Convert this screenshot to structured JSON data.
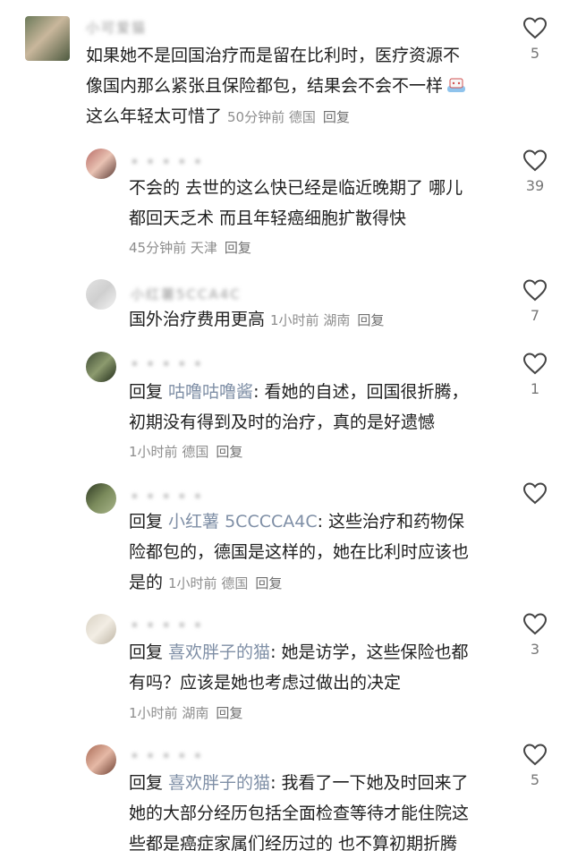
{
  "comments": [
    {
      "name": "小可爱猫",
      "lines": [
        "如果她不是回国治疗而是留在比利时，医疗资源不",
        "像国内那么紧张且保险都包，结果会不会不一样",
        "这么年轻太可惜了"
      ],
      "meta": {
        "time": "50分钟前",
        "location": "德国",
        "reply": "回复"
      },
      "likes": "5",
      "avatar_colors": [
        "#6c7a5a",
        "#c9b79c",
        "#4d5a3f"
      ]
    },
    {
      "name": "• • • • •",
      "lines": [
        "不会的 去世的这么快已经是临近晚期了 哪儿",
        "都回天乏术 而且年轻癌细胞扩散得快"
      ],
      "meta": {
        "time": "45分钟前",
        "location": "天津",
        "reply": "回复"
      },
      "likes": "39",
      "avatar_colors": [
        "#b86c66",
        "#e9c2b3",
        "#5a3a34"
      ]
    },
    {
      "name": "小红薯5CCA4C",
      "lines": [
        "国外治疗费用更高"
      ],
      "meta": {
        "time": "1小时前",
        "location": "湖南",
        "reply": "回复"
      },
      "likes": "7",
      "avatar_colors": [
        "#e3e3e3",
        "#cfcfcf",
        "#f4f4f4"
      ]
    },
    {
      "name": "• • • • •",
      "prefix": "回复 ",
      "mention": "咕噜咕噜酱",
      "lines": [
        ": 看她的自述，回国很折腾，",
        "初期没有得到及时的治疗，真的是好遗憾"
      ],
      "meta": {
        "time": "1小时前",
        "location": "德国",
        "reply": "回复"
      },
      "likes": "1",
      "avatar_colors": [
        "#3e4b34",
        "#8c9a6e",
        "#1f2a18"
      ]
    },
    {
      "name": "• • • • •",
      "prefix": "回复 ",
      "mention": "小红薯 5CCCCA4C",
      "lines": [
        ": 这些治疗和药物保",
        "险都包的，德国是这样的，她在比利时应该也",
        "是的"
      ],
      "meta": {
        "time": "1小时前",
        "location": "德国",
        "reply": "回复"
      },
      "likes": "",
      "avatar_colors": [
        "#2f3a24",
        "#7b8b5c",
        "#a8b58a"
      ]
    },
    {
      "name": "• • • • •",
      "prefix": "回复 ",
      "mention": "喜欢胖子的猫",
      "lines": [
        ": 她是访学，这些保险也都",
        "有吗？应该是她也考虑过做出的决定"
      ],
      "meta": {
        "time": "1小时前",
        "location": "湖南",
        "reply": "回复"
      },
      "likes": "3",
      "avatar_colors": [
        "#d9d2c4",
        "#f2ede4",
        "#bdb4a3"
      ]
    },
    {
      "name": "• • • • •",
      "prefix": "回复 ",
      "mention": "喜欢胖子的猫",
      "lines": [
        ": 我看了一下她及时回来了",
        "她的大部分经历包括全面检查等待才能住院这",
        "些都是癌症家属们经历过的 也不算初期折腾"
      ],
      "meta": {
        "time": "",
        "location": "",
        "reply": ""
      },
      "likes": "5",
      "avatar_colors": [
        "#a96a55",
        "#e6b9a6",
        "#6d3f31"
      ]
    }
  ],
  "emoji_name": "party-emoji"
}
